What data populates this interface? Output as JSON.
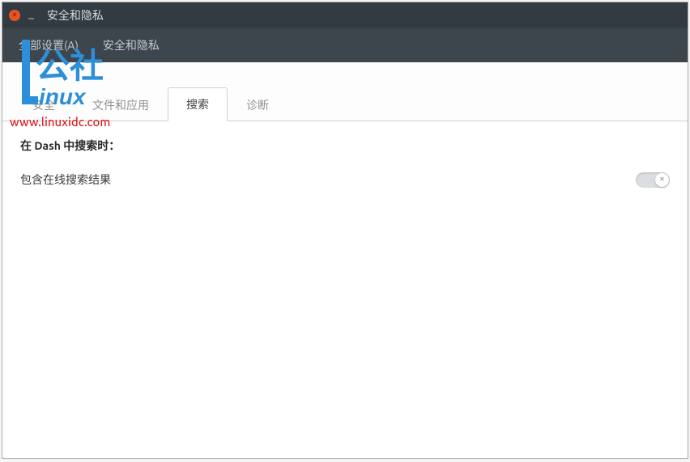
{
  "window": {
    "title": "安全和隐私"
  },
  "breadcrumb": {
    "all_settings": "全部设置(A)",
    "current": "安全和隐私"
  },
  "tabs": {
    "security": "安全",
    "files": "文件和应用",
    "search": "搜索",
    "diagnostics": "诊断"
  },
  "content": {
    "section_title": "在 Dash 中搜索时：",
    "online_results_label": "包含在线搜索结果"
  },
  "watermark": {
    "logo_top": "公社",
    "logo_bottom": "inux",
    "url": "www.linuxidc.com"
  }
}
